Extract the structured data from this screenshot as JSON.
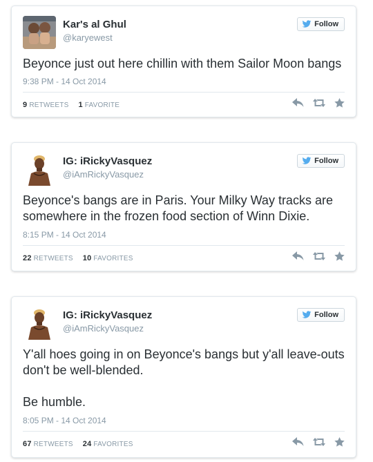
{
  "colors": {
    "twitter_blue": "#55acee",
    "text": "#292f33",
    "muted": "#8899a6",
    "action_icon": "#8899a6"
  },
  "tweets": [
    {
      "name": "Kar's al Ghul",
      "handle": "@karyewest",
      "follow_label": "Follow",
      "text": "Beyonce just out here chillin with them Sailor Moon bangs",
      "time": "9:38 PM - 14 Oct 2014",
      "retweets_count": "9",
      "retweets_label": "RETWEETS",
      "favorites_count": "1",
      "favorites_label": "FAVORITE",
      "icons": [
        "reply-icon",
        "retweet-icon",
        "favorite-star-icon"
      ]
    },
    {
      "name": "IG: iRickyVasquez",
      "handle": "@iAmRickyVasquez",
      "follow_label": "Follow",
      "text": "Beyonce's bangs are in Paris. Your Milky Way tracks are somewhere in the frozen food section of Winn Dixie.",
      "time": "8:15 PM - 14 Oct 2014",
      "retweets_count": "22",
      "retweets_label": "RETWEETS",
      "favorites_count": "10",
      "favorites_label": "FAVORITES",
      "icons": [
        "reply-icon",
        "retweet-icon",
        "favorite-star-icon"
      ]
    },
    {
      "name": "IG: iRickyVasquez",
      "handle": "@iAmRickyVasquez",
      "follow_label": "Follow",
      "text": "Y'all hoes going in on Beyonce's bangs but y'all leave-outs don't be well-blended.\n\nBe humble.",
      "time": "8:05 PM - 14 Oct 2014",
      "retweets_count": "67",
      "retweets_label": "RETWEETS",
      "favorites_count": "24",
      "favorites_label": "FAVORITES",
      "icons": [
        "reply-icon",
        "retweet-icon",
        "favorite-star-icon"
      ]
    }
  ]
}
